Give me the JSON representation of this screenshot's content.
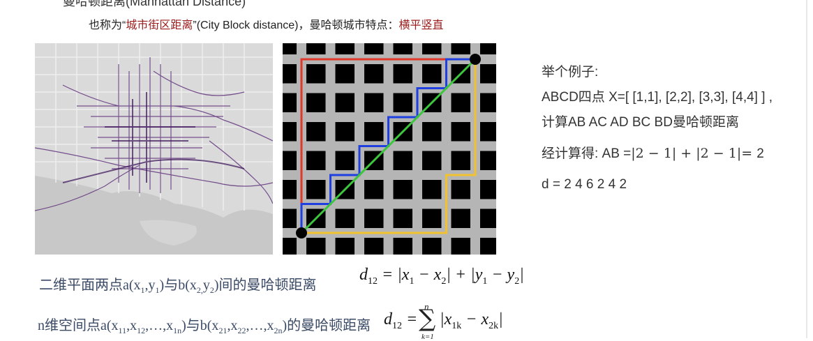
{
  "heading": "曼哈顿距离(Manhattan Distance)",
  "subtitle": {
    "prefix": "也称为“",
    "highlight": "城市街区距离",
    "middle": "”(City Block distance)，曼哈顿城市特点：",
    "feature": "横平竖直"
  },
  "example": {
    "line1": "举个例子:",
    "line2": "ABCD四点 X=[ [1,1], [2,2], [3,3], [4,4] ] ,",
    "line3": "计算AB AC AD BC BD曼哈顿距离",
    "line4_prefix": "经计算得: AB =",
    "line4_formula": "|2 − 1| +  |2 − 1|= ",
    "line4_result": "2",
    "line5": "d = 2 4 6 2 4 2"
  },
  "formula2d": {
    "label_a": "二维平面两点a(x",
    "label_b": "间的曼哈顿距离",
    "expr": "d12 = |x1 − x2| + |y1 − y2|"
  },
  "formulaNd": {
    "label_a": "n维空间点a(x",
    "label_b": "的曼哈顿距离",
    "sum_upper": "n",
    "sum_lower": "k=1",
    "expr": "d12 = Σ |x1k − x2k|"
  },
  "colors": {
    "accent_red": "#9b1b1b",
    "path_red": "#e0392b",
    "path_blue": "#1f3fe0",
    "path_yellow": "#f2c12e",
    "path_green": "#3cc63c"
  }
}
